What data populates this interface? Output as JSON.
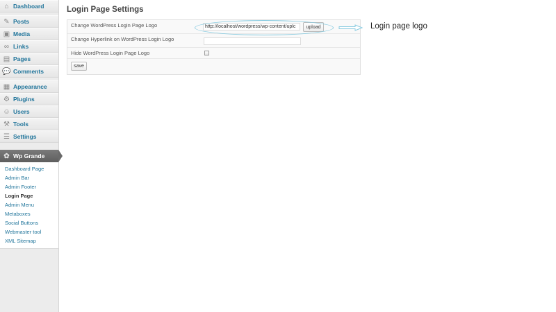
{
  "sidebar": {
    "items": [
      {
        "label": "Dashboard",
        "icon": "dashboard-icon"
      },
      {
        "label": "Posts",
        "icon": "posts-icon"
      },
      {
        "label": "Media",
        "icon": "media-icon"
      },
      {
        "label": "Links",
        "icon": "links-icon"
      },
      {
        "label": "Pages",
        "icon": "pages-icon"
      },
      {
        "label": "Comments",
        "icon": "comments-icon"
      },
      {
        "label": "Appearance",
        "icon": "appearance-icon"
      },
      {
        "label": "Plugins",
        "icon": "plugins-icon"
      },
      {
        "label": "Users",
        "icon": "users-icon"
      },
      {
        "label": "Tools",
        "icon": "tools-icon"
      },
      {
        "label": "Settings",
        "icon": "settings-icon"
      }
    ],
    "plugin_menu": {
      "label": "Wp Grande",
      "icon": "gear-icon",
      "subitems": [
        "Dashboard Page",
        "Admin Bar",
        "Admin Footer",
        "Login Page",
        "Admin Menu",
        "Metaboxes",
        "Social Buttons",
        "Webmaster tool",
        "XML Sitemap"
      ],
      "current": "Login Page"
    }
  },
  "main": {
    "title": "Login Page Settings",
    "rows": {
      "logo_label": "Change WordPress Login Page Logo",
      "logo_value": "http://localhost/wordpress/wp-content/uplc",
      "upload_label": "upload",
      "link_label": "Change Hyperlink on WordPress Login Logo",
      "link_value": "",
      "hide_label": "Hide WordPress Login Page Logo",
      "hide_checked": false
    },
    "save_label": "save"
  },
  "annotation": {
    "label": "Login page logo",
    "color": "#88cbe0"
  },
  "colors": {
    "link": "#21759b",
    "sidebar_bg": "#ececec",
    "plugin_header": "#6a6a6a"
  }
}
